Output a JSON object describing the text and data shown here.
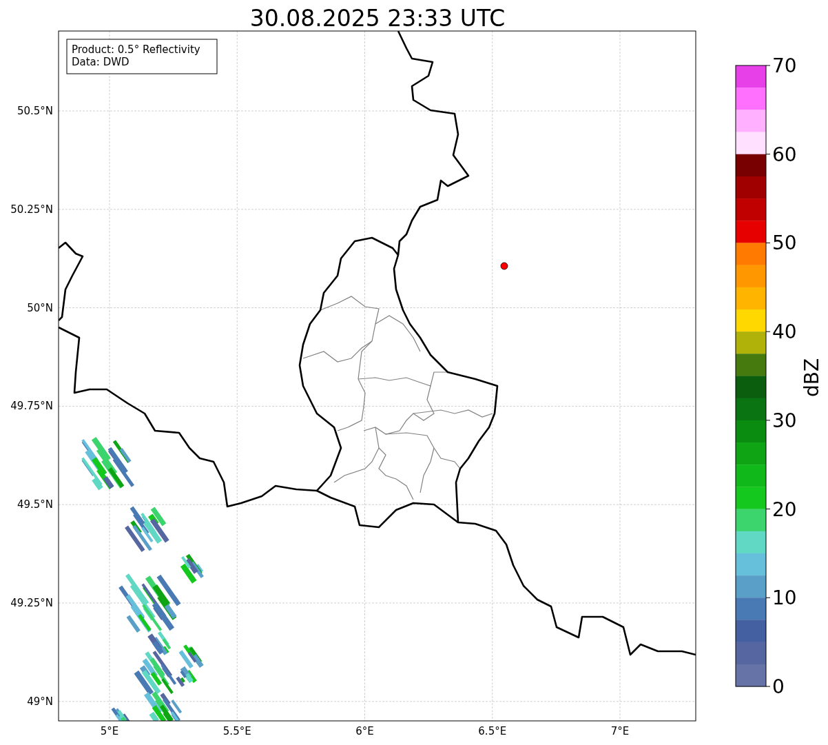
{
  "title": "30.08.2025 23:33 UTC",
  "info_box": {
    "lines": [
      "Product: 0.5° Reflectivity",
      "Data: DWD"
    ]
  },
  "x_ticks": [
    "5°E",
    "5.5°E",
    "6°E",
    "6.5°E",
    "7°E"
  ],
  "y_ticks": [
    "50.5°N",
    "50.25°N",
    "50°N",
    "49.75°N",
    "49.5°N",
    "49.25°N",
    "49°N"
  ],
  "colorbar": {
    "label": "dBZ",
    "ticks": [
      "70",
      "60",
      "50",
      "40",
      "30",
      "20",
      "10",
      "0"
    ],
    "bands": [
      {
        "color": "#e840e8"
      },
      {
        "color": "#ff70ff"
      },
      {
        "color": "#ffb0ff"
      },
      {
        "color": "#ffe0ff"
      },
      {
        "color": "#780000"
      },
      {
        "color": "#a00000"
      },
      {
        "color": "#c00000"
      },
      {
        "color": "#e60000"
      },
      {
        "color": "#ff7a00"
      },
      {
        "color": "#ff9800"
      },
      {
        "color": "#ffb400"
      },
      {
        "color": "#ffd800"
      },
      {
        "color": "#b0b20a"
      },
      {
        "color": "#467a0e"
      },
      {
        "color": "#0a5e0e"
      },
      {
        "color": "#0a7412"
      },
      {
        "color": "#0a8c10"
      },
      {
        "color": "#0ea414"
      },
      {
        "color": "#10b81a"
      },
      {
        "color": "#14c81e"
      },
      {
        "color": "#3cd46c"
      },
      {
        "color": "#60d8c4"
      },
      {
        "color": "#66c0dc"
      },
      {
        "color": "#5a9fc8"
      },
      {
        "color": "#4a7ab4"
      },
      {
        "color": "#4560a0"
      },
      {
        "color": "#5566a0"
      },
      {
        "color": "#6673a6"
      }
    ]
  }
}
